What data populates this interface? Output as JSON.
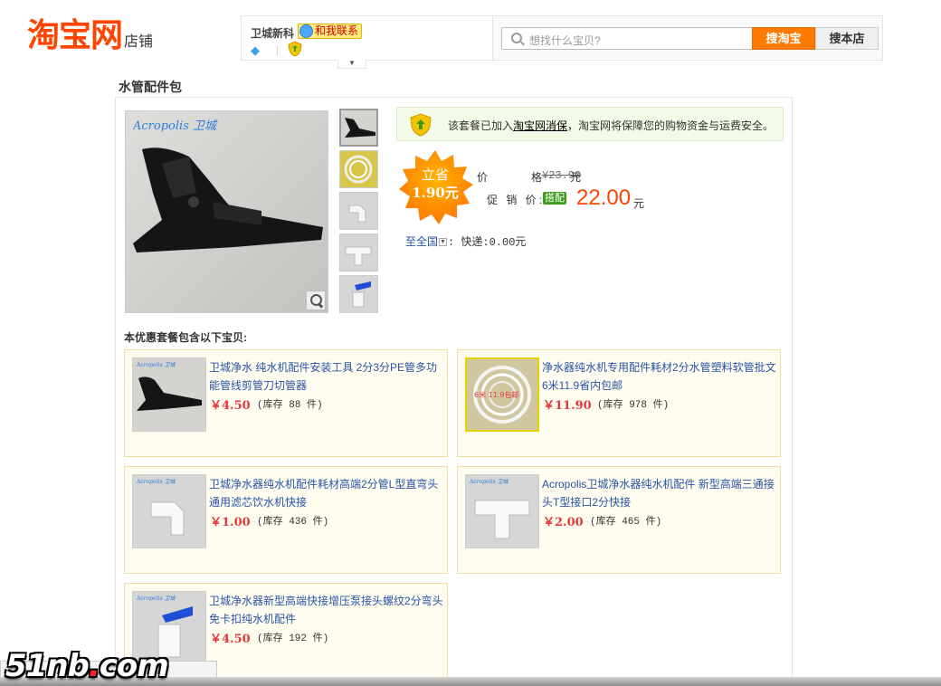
{
  "header": {
    "logo_main": "淘宝网",
    "logo_sub": "店铺",
    "shop_name": "卫城新科",
    "contact_label": "和我联系",
    "search_placeholder": "想找什么宝贝?",
    "search_taobao_label": "搜淘宝",
    "search_shop_label": "搜本店"
  },
  "page_title": "水管配件包",
  "product": {
    "image_brand": "Acropolis 卫城",
    "guarantee": {
      "prefix": "该套餐已加入",
      "link": "淘宝网消保",
      "suffix": "，淘宝网将保障您的购物资金与运费安全。"
    },
    "saving_label": "立省",
    "saving_amount": "1.90元",
    "original_price_label_a": "价",
    "original_price_label_b": "格",
    "original_price": "¥23.90",
    "original_price_unit": "元",
    "promo_label": "促 销 价:",
    "promo_tag": "搭配",
    "promo_price": "22.00",
    "promo_unit": "元",
    "ship_region": "至全国",
    "ship_text": ": 快递:0.00元"
  },
  "bundle": {
    "heading": "本优惠套餐包含以下宝贝:",
    "items": [
      {
        "title": "卫城净水 纯水机配件安装工具 2分3分PE管多功能管线剪管刀切管器",
        "price": "￥4.50",
        "stock": "(库存 88 件)",
        "img_label": "Acropolis 卫城"
      },
      {
        "title": "净水器纯水机专用配件耗材2分水管塑料软管批文6米11.9省内包邮",
        "price": "￥11.90",
        "stock": "(库存 978 件)",
        "img_label": "6米 11.9包邮"
      },
      {
        "title": "卫城净水器纯水机配件耗材高端2分管L型直弯头通用滤芯饮水机快接",
        "price": "￥1.00",
        "stock": "(库存 436 件)",
        "img_label": "Acropolis 卫城"
      },
      {
        "title": "Acropolis卫城净水器纯水机配件 新型高端三通接头T型接口2分快接",
        "price": "￥2.00",
        "stock": "(库存 465 件)",
        "img_label": "Acropolis 卫城"
      },
      {
        "title": "卫城净水器新型高端快接增压泵接头螺纹2分弯头免卡扣纯水机配件",
        "price": "￥4.50",
        "stock": "(库存 192 件)",
        "img_label": "Acropolis 卫城"
      }
    ]
  },
  "watermark": {
    "part1": "51nb",
    "dot": ".",
    "part2": "com"
  },
  "colors": {
    "brand_orange": "#ff4400",
    "search_button": "#ff7b00",
    "link_blue": "#2953a6",
    "price_red": "#e4393c"
  }
}
